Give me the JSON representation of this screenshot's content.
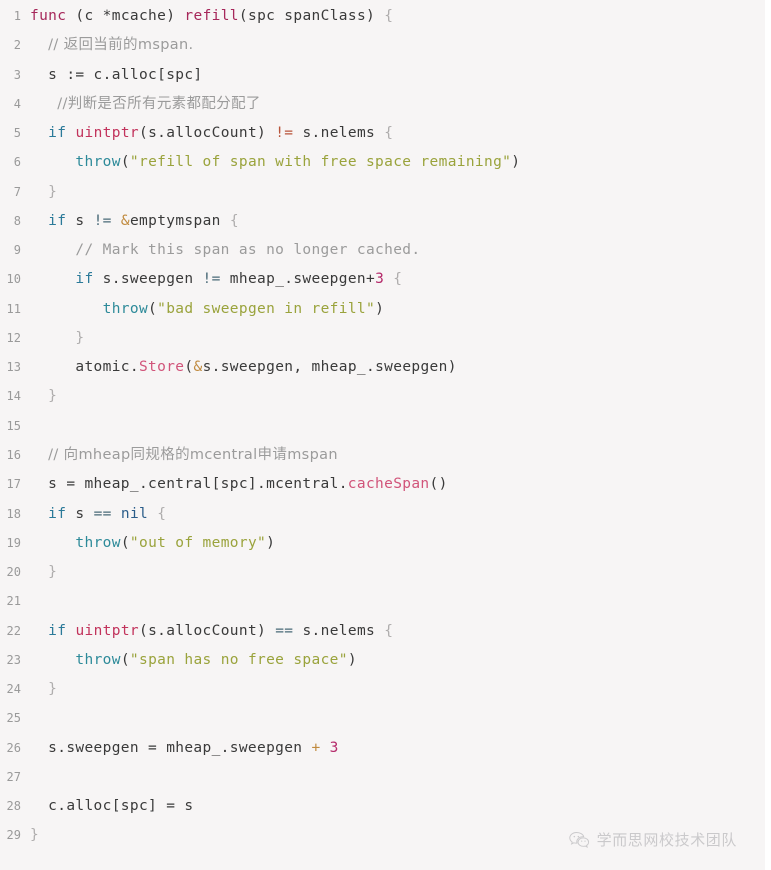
{
  "editor": {
    "language": "go",
    "background_color": "#f7f5f5",
    "gutter_color": "#9a9a9a",
    "total_lines": 29
  },
  "lines": [
    {
      "no": "1",
      "tokens": [
        {
          "t": "func",
          "c": "kw"
        },
        {
          "t": " ",
          "c": "plain"
        },
        {
          "t": "(c *mcache)",
          "c": "plain"
        },
        {
          "t": " ",
          "c": "plain"
        },
        {
          "t": "refill",
          "c": "kw"
        },
        {
          "t": "(",
          "c": "plain"
        },
        {
          "t": "spc spanClass",
          "c": "plain"
        },
        {
          "t": ")",
          "c": "plain"
        },
        {
          "t": " ",
          "c": "plain"
        },
        {
          "t": "{",
          "c": "brace"
        }
      ]
    },
    {
      "no": "2",
      "tokens": [
        {
          "t": "  ",
          "c": "plain"
        },
        {
          "t": "// 返回当前的mspan.",
          "c": "cmt cn"
        }
      ]
    },
    {
      "no": "3",
      "tokens": [
        {
          "t": "  s := c.alloc[spc]",
          "c": "plain"
        }
      ]
    },
    {
      "no": "4",
      "tokens": [
        {
          "t": "   ",
          "c": "plain"
        },
        {
          "t": "//判断是否所有元素都配分配了",
          "c": "cmt cn"
        }
      ]
    },
    {
      "no": "5",
      "tokens": [
        {
          "t": "  ",
          "c": "plain"
        },
        {
          "t": "if",
          "c": "kw2"
        },
        {
          "t": " ",
          "c": "plain"
        },
        {
          "t": "uintptr",
          "c": "type"
        },
        {
          "t": "(s.allocCount)",
          "c": "plain"
        },
        {
          "t": " ",
          "c": "plain"
        },
        {
          "t": "!=",
          "c": "oprd"
        },
        {
          "t": " s.nelems ",
          "c": "plain"
        },
        {
          "t": "{",
          "c": "brace"
        }
      ]
    },
    {
      "no": "6",
      "tokens": [
        {
          "t": "     ",
          "c": "plain"
        },
        {
          "t": "throw",
          "c": "call"
        },
        {
          "t": "(",
          "c": "plain"
        },
        {
          "t": "\"refill of span with free space remaining\"",
          "c": "str"
        },
        {
          "t": ")",
          "c": "plain"
        }
      ]
    },
    {
      "no": "7",
      "tokens": [
        {
          "t": "  ",
          "c": "plain"
        },
        {
          "t": "}",
          "c": "brace"
        }
      ]
    },
    {
      "no": "8",
      "tokens": [
        {
          "t": "  ",
          "c": "plain"
        },
        {
          "t": "if",
          "c": "kw2"
        },
        {
          "t": " s ",
          "c": "plain"
        },
        {
          "t": "!=",
          "c": "op"
        },
        {
          "t": " ",
          "c": "plain"
        },
        {
          "t": "&",
          "c": "amp"
        },
        {
          "t": "emptymspan ",
          "c": "plain"
        },
        {
          "t": "{",
          "c": "brace"
        }
      ]
    },
    {
      "no": "9",
      "tokens": [
        {
          "t": "     ",
          "c": "plain"
        },
        {
          "t": "// Mark this span as no longer cached.",
          "c": "cmt"
        }
      ]
    },
    {
      "no": "10",
      "tokens": [
        {
          "t": "     ",
          "c": "plain"
        },
        {
          "t": "if",
          "c": "kw2"
        },
        {
          "t": " s.sweepgen ",
          "c": "plain"
        },
        {
          "t": "!=",
          "c": "op"
        },
        {
          "t": " mheap_.sweepgen",
          "c": "plain"
        },
        {
          "t": "+",
          "c": "plain"
        },
        {
          "t": "3",
          "c": "num"
        },
        {
          "t": " ",
          "c": "plain"
        },
        {
          "t": "{",
          "c": "brace"
        }
      ]
    },
    {
      "no": "11",
      "tokens": [
        {
          "t": "        ",
          "c": "plain"
        },
        {
          "t": "throw",
          "c": "call"
        },
        {
          "t": "(",
          "c": "plain"
        },
        {
          "t": "\"bad sweepgen in refill\"",
          "c": "str"
        },
        {
          "t": ")",
          "c": "plain"
        }
      ]
    },
    {
      "no": "12",
      "tokens": [
        {
          "t": "     ",
          "c": "plain"
        },
        {
          "t": "}",
          "c": "brace"
        }
      ]
    },
    {
      "no": "13",
      "tokens": [
        {
          "t": "     atomic.",
          "c": "plain"
        },
        {
          "t": "Store",
          "c": "fn"
        },
        {
          "t": "(",
          "c": "plain"
        },
        {
          "t": "&",
          "c": "amp"
        },
        {
          "t": "s.sweepgen, mheap_.sweepgen)",
          "c": "plain"
        }
      ]
    },
    {
      "no": "14",
      "tokens": [
        {
          "t": "  ",
          "c": "plain"
        },
        {
          "t": "}",
          "c": "brace"
        }
      ]
    },
    {
      "no": "15",
      "tokens": [
        {
          "t": "",
          "c": "plain"
        }
      ]
    },
    {
      "no": "16",
      "tokens": [
        {
          "t": "  ",
          "c": "plain"
        },
        {
          "t": "// 向mheap同规格的mcentral申请mspan",
          "c": "cmt cn"
        }
      ]
    },
    {
      "no": "17",
      "tokens": [
        {
          "t": "  s = mheap_.central[spc].mcentral.",
          "c": "plain"
        },
        {
          "t": "cacheSpan",
          "c": "fn"
        },
        {
          "t": "()",
          "c": "plain"
        }
      ]
    },
    {
      "no": "18",
      "tokens": [
        {
          "t": "  ",
          "c": "plain"
        },
        {
          "t": "if",
          "c": "kw2"
        },
        {
          "t": " s ",
          "c": "plain"
        },
        {
          "t": "==",
          "c": "op"
        },
        {
          "t": " ",
          "c": "plain"
        },
        {
          "t": "nil",
          "c": "nil"
        },
        {
          "t": " ",
          "c": "plain"
        },
        {
          "t": "{",
          "c": "brace"
        }
      ]
    },
    {
      "no": "19",
      "tokens": [
        {
          "t": "     ",
          "c": "plain"
        },
        {
          "t": "throw",
          "c": "call"
        },
        {
          "t": "(",
          "c": "plain"
        },
        {
          "t": "\"out of memory\"",
          "c": "str"
        },
        {
          "t": ")",
          "c": "plain"
        }
      ]
    },
    {
      "no": "20",
      "tokens": [
        {
          "t": "  ",
          "c": "plain"
        },
        {
          "t": "}",
          "c": "brace"
        }
      ]
    },
    {
      "no": "21",
      "tokens": [
        {
          "t": "",
          "c": "plain"
        }
      ]
    },
    {
      "no": "22",
      "tokens": [
        {
          "t": "  ",
          "c": "plain"
        },
        {
          "t": "if",
          "c": "kw2"
        },
        {
          "t": " ",
          "c": "plain"
        },
        {
          "t": "uintptr",
          "c": "type"
        },
        {
          "t": "(s.allocCount)",
          "c": "plain"
        },
        {
          "t": " ",
          "c": "plain"
        },
        {
          "t": "==",
          "c": "op"
        },
        {
          "t": " s.nelems ",
          "c": "plain"
        },
        {
          "t": "{",
          "c": "brace"
        }
      ]
    },
    {
      "no": "23",
      "tokens": [
        {
          "t": "     ",
          "c": "plain"
        },
        {
          "t": "throw",
          "c": "call"
        },
        {
          "t": "(",
          "c": "plain"
        },
        {
          "t": "\"span has no free space\"",
          "c": "str"
        },
        {
          "t": ")",
          "c": "plain"
        }
      ]
    },
    {
      "no": "24",
      "tokens": [
        {
          "t": "  ",
          "c": "plain"
        },
        {
          "t": "}",
          "c": "brace"
        }
      ]
    },
    {
      "no": "25",
      "tokens": [
        {
          "t": "",
          "c": "plain"
        }
      ]
    },
    {
      "no": "26",
      "tokens": [
        {
          "t": "  s.sweepgen = mheap_.sweepgen ",
          "c": "plain"
        },
        {
          "t": "+",
          "c": "amp"
        },
        {
          "t": " ",
          "c": "plain"
        },
        {
          "t": "3",
          "c": "num"
        }
      ]
    },
    {
      "no": "27",
      "tokens": [
        {
          "t": "",
          "c": "plain"
        }
      ]
    },
    {
      "no": "28",
      "tokens": [
        {
          "t": "  c.alloc[spc] = s",
          "c": "plain"
        }
      ]
    },
    {
      "no": "29",
      "tokens": [
        {
          "t": "}",
          "c": "brace"
        }
      ]
    }
  ],
  "watermark": {
    "text": "学而思网校技术团队",
    "icon": "wechat-icon",
    "color": "#8e8e92"
  }
}
